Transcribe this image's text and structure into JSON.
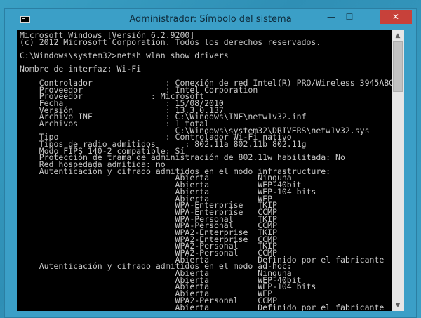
{
  "window": {
    "title": "Administrador: Símbolo del sistema",
    "minimize_glyph": "—",
    "maximize_glyph": "☐",
    "close_glyph": "✕",
    "icon": "cmd-icon",
    "accent_color": "#3b9fc7",
    "close_color": "#c7413a"
  },
  "scrollbar": {
    "up_glyph": "▲",
    "down_glyph": "▼"
  },
  "console": {
    "lines": [
      "Microsoft Windows [Versión 6.2.9200]",
      "(c) 2012 Microsoft Corporation. Todos los derechos reservados.",
      "",
      "C:\\Windows\\system32>netsh wlan show drivers",
      "",
      "Nombre de interfaz: Wi-Fi",
      "",
      "    Controlador               : Conexión de red Intel(R) PRO/Wireless 3945ABG",
      "    Proveedor                 : Intel Corporation",
      "    Proveedor              : Microsoft",
      "    Fecha                     : 15/08/2010",
      "    Versión                   : 13.3.0.137",
      "    Archivo INF               : C:\\Windows\\INF\\netw1v32.inf",
      "    Archivos                  : 1 total",
      "                                C:\\Windows\\system32\\DRIVERS\\netw1v32.sys",
      "    Tipo                      : Controlador Wi-Fi nativo",
      "    Tipos de radio admitidos      : 802.11a 802.11b 802.11g",
      "    Modo FIPS 140-2 compatible: Sí",
      "    Protección de trama de administración de 802.11w habilitada: No",
      "    Red hospedada admitida: no",
      "    Autenticación y cifrado admitidos en el modo infrastructure:",
      "                                Abierta          Ninguna",
      "                                Abierta          WEP-40bit",
      "                                Abierta          WEP-104 bits",
      "                                Abierta          WEP",
      "                                WPA-Enterprise   TKIP",
      "                                WPA-Enterprise   CCMP",
      "                                WPA-Personal     TKIP",
      "                                WPA-Personal     CCMP",
      "                                WPA2-Enterprise  TKIP",
      "                                WPA2-Enterprise  CCMP",
      "                                WPA2-Personal    TKIP",
      "                                WPA2-Personal    CCMP",
      "                                Abierta          Definido por el fabricante",
      "    Autenticación y cifrado admitidos en el modo ad-hoc:",
      "                                Abierta          Ninguna",
      "                                Abierta          WEP-40bit",
      "                                Abierta          WEP-104 bits",
      "                                Abierta          WEP",
      "                                WPA2-Personal    CCMP",
      "                                Abierta          Definido por el fabricante"
    ]
  }
}
